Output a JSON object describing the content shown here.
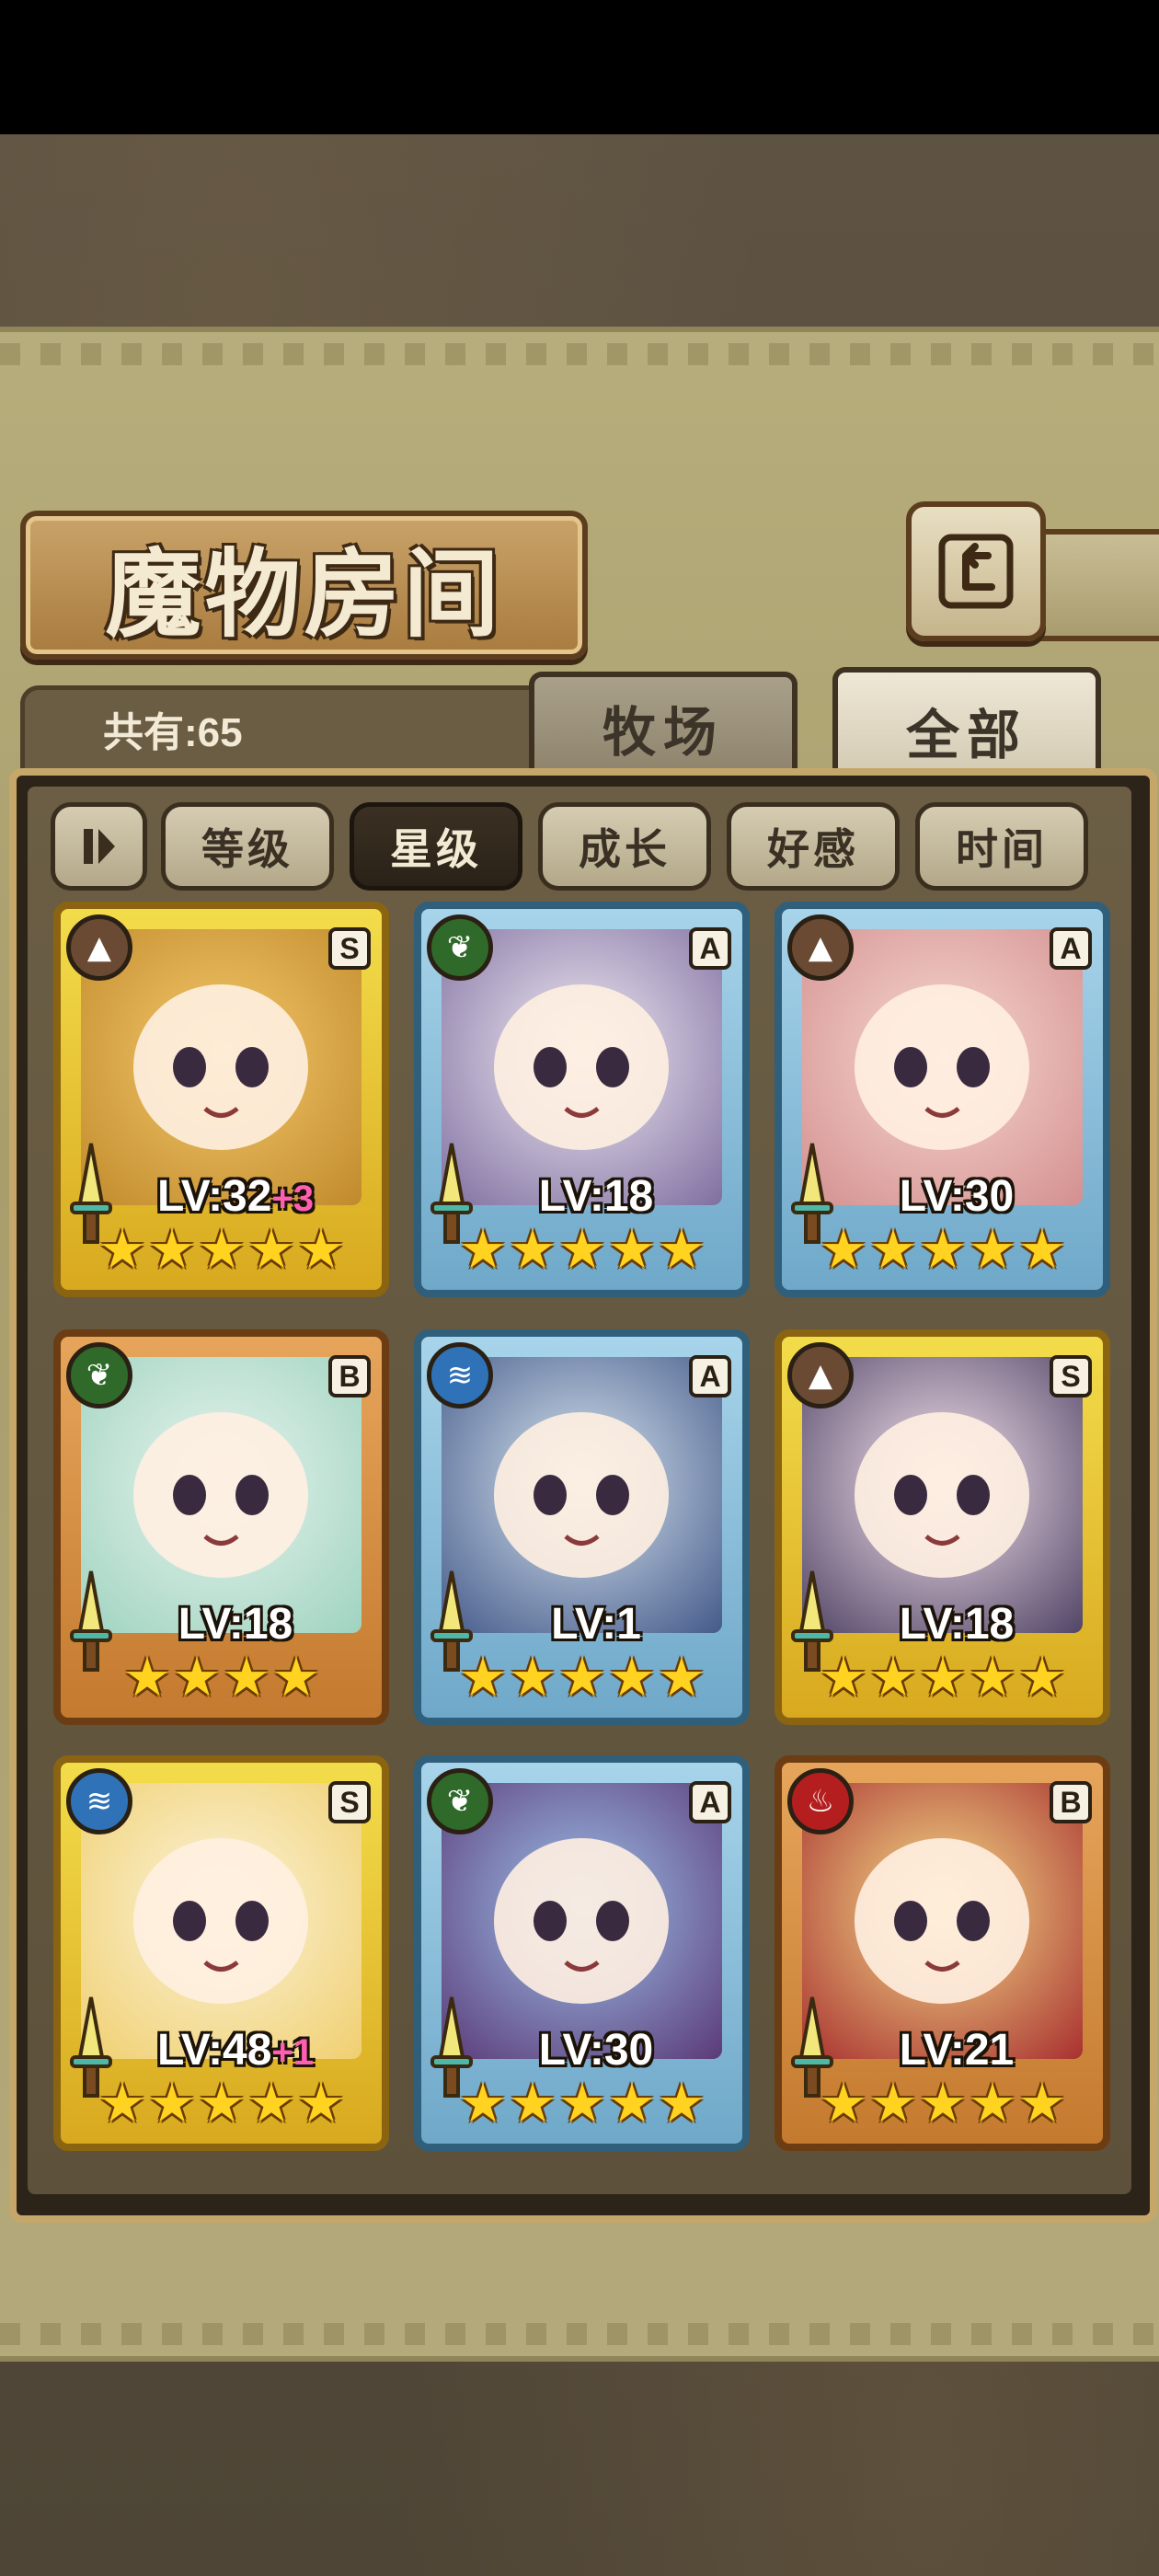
{
  "header": {
    "title": "魔物房间"
  },
  "info": {
    "total": "共有:65"
  },
  "tabs": [
    {
      "label": "牧场",
      "active": false
    },
    {
      "label": "全部",
      "active": true
    }
  ],
  "sort": {
    "toggle_icon": "sort-order-icon",
    "buttons": [
      {
        "label": "等级",
        "active": false
      },
      {
        "label": "星级",
        "active": true
      },
      {
        "label": "成长",
        "active": false
      },
      {
        "label": "好感",
        "active": false
      },
      {
        "label": "时间",
        "active": false
      }
    ]
  },
  "monsters": [
    {
      "element": "earth",
      "rank": "S",
      "frame": "gold",
      "level": "LV:32",
      "bonus": "+3",
      "stars": 5
    },
    {
      "element": "grass",
      "rank": "A",
      "frame": "blue",
      "level": "LV:18",
      "bonus": "",
      "stars": 5
    },
    {
      "element": "earth",
      "rank": "A",
      "frame": "blue",
      "level": "LV:30",
      "bonus": "",
      "stars": 5
    },
    {
      "element": "grass",
      "rank": "B",
      "frame": "bronze",
      "level": "LV:18",
      "bonus": "",
      "stars": 4
    },
    {
      "element": "water",
      "rank": "A",
      "frame": "blue",
      "level": "LV:1",
      "bonus": "",
      "stars": 5
    },
    {
      "element": "earth",
      "rank": "S",
      "frame": "gold",
      "level": "LV:18",
      "bonus": "",
      "stars": 5
    },
    {
      "element": "water",
      "rank": "S",
      "frame": "gold",
      "level": "LV:48",
      "bonus": "+1",
      "stars": 5
    },
    {
      "element": "grass",
      "rank": "A",
      "frame": "blue",
      "level": "LV:30",
      "bonus": "",
      "stars": 5
    },
    {
      "element": "fire",
      "rank": "B",
      "frame": "bronze",
      "level": "LV:21",
      "bonus": "",
      "stars": 5
    }
  ],
  "colors": {
    "gold_frame": "#f3dc4a",
    "blue_frame": "#a7d4ea",
    "bronze_frame": "#e6a55b",
    "star": "#ffd31f",
    "bonus": "#ff5fb0"
  }
}
